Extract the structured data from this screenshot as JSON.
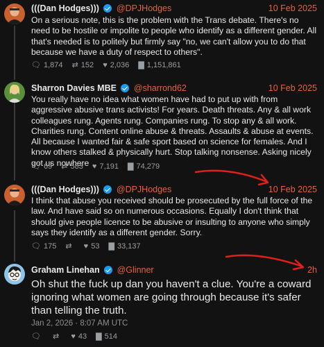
{
  "tweets": [
    {
      "name": "(((Dan Hodges)))",
      "handle": "@DPJHodges",
      "date": "10 Feb 2025",
      "text": "On a serious note, this is the problem with the Trans debate. There's no need to be hostile or impolite to people who identify as a different gender. All that's needed is to politely but firmly say \"no, we can't allow you to do that because we have a duty of respect to others\".",
      "replies": "1,874",
      "retweets": "152",
      "likes": "2,036",
      "views": "1,151,861"
    },
    {
      "name": "Sharron Davies MBE",
      "handle": "@sharrond62",
      "date": "10 Feb 2025",
      "text": "You really have no idea what women have had to put up with from aggressive abusive trans activists! For years. Death threats. Any & all work colleagues rung. Agents rung. Companies rung. To stop any & all work. Charities rung. Content online abuse & threats. Assaults & abuse at events. All because I wanted fair & safe sport based on science for females. And I know others stalked & physically hurt. Stop talking nonsense. Asking nicely got us nowhere",
      "replies": "69",
      "retweets": "583",
      "likes": "7,191",
      "views": "74,279"
    },
    {
      "name": "(((Dan Hodges)))",
      "handle": "@DPJHodges",
      "date": "10 Feb 2025",
      "text": "I think that abuse you received should be prosecuted by the full force of the law. And have said so on numerous occasions. Equally I don't think that should give people licence to be abusive or insulting to anyone who simply says they identify as a  different gender.  Sorry.",
      "replies": "175",
      "retweets": "",
      "likes": "53",
      "views": "33,137"
    },
    {
      "name": "Graham Linehan",
      "handle": "@Glinner",
      "date": "2h",
      "text": "Oh shut the fuck up dan you haven't a clue. You're a coward ignoring what women are going through because it's safer than telling the truth.",
      "timestamp": "Jan 2, 2026 · 8:07 AM UTC",
      "replies": "",
      "retweets": "",
      "likes": "43",
      "views": "514"
    }
  ],
  "icons": [
    "reply-icon",
    "retweet-icon",
    "like-icon",
    "views-icon",
    "verified-icon"
  ],
  "colors": {
    "accent": "#e8613a",
    "annotation": "#e0201a",
    "background": "#121212"
  }
}
